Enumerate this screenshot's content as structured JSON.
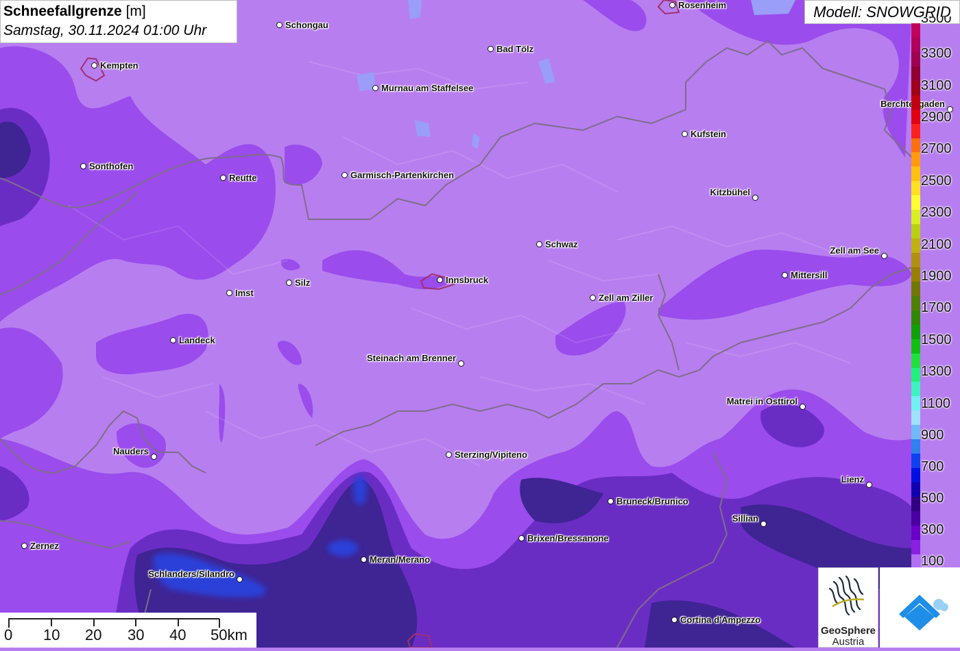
{
  "title": {
    "main": "Schneefallgrenze",
    "unit": "[m]",
    "datetime": "Samstag, 30.11.2024 01:00 Uhr"
  },
  "model": "Modell: SNOWGRID",
  "cities": [
    {
      "name": "Rosenheim",
      "side": "right"
    },
    {
      "name": "Schongau",
      "side": "right"
    },
    {
      "name": "Bad Tölz",
      "side": "right"
    },
    {
      "name": "Kempten",
      "side": "right"
    },
    {
      "name": "Murnau am Staffelsee",
      "side": "right"
    },
    {
      "name": "Berchtesgaden",
      "side": "left"
    },
    {
      "name": "Kufstein",
      "side": "right"
    },
    {
      "name": "Sonthofen",
      "side": "right"
    },
    {
      "name": "Reutte",
      "side": "right"
    },
    {
      "name": "Garmisch-Partenkirchen",
      "side": "right"
    },
    {
      "name": "Kitzbühel",
      "side": "left"
    },
    {
      "name": "Schwaz",
      "side": "right"
    },
    {
      "name": "Zell am See",
      "side": "left"
    },
    {
      "name": "Mittersill",
      "side": "right"
    },
    {
      "name": "Silz",
      "side": "right"
    },
    {
      "name": "Innsbruck",
      "side": "right"
    },
    {
      "name": "Imst",
      "side": "right"
    },
    {
      "name": "Zell am Ziller",
      "side": "right"
    },
    {
      "name": "Landeck",
      "side": "right"
    },
    {
      "name": "Steinach am Brenner",
      "side": "left"
    },
    {
      "name": "Matrei in Osttirol",
      "side": "left"
    },
    {
      "name": "Nauders",
      "side": "left"
    },
    {
      "name": "Sterzing/Vipiteno",
      "side": "right"
    },
    {
      "name": "Lienz",
      "side": "left"
    },
    {
      "name": "Bruneck/Brunico",
      "side": "right"
    },
    {
      "name": "Sillian",
      "side": "left"
    },
    {
      "name": "Brixen/Bressanone",
      "side": "right"
    },
    {
      "name": "Zernez",
      "side": "right"
    },
    {
      "name": "Meran/Merano",
      "side": "right"
    },
    {
      "name": "Schlanders/Silandro",
      "side": "left"
    },
    {
      "name": "Cortina d'Ampezzo",
      "side": "right"
    }
  ],
  "legend": {
    "labels": [
      "3300",
      "3100",
      "2900",
      "2700",
      "2500",
      "2300",
      "2100",
      "1900",
      "1700",
      "1500",
      "1300",
      "1100",
      "900",
      "700",
      "500",
      "300",
      "100"
    ],
    "top_partial_label": "3500",
    "colors": [
      "#c0005a",
      "#b0005a",
      "#a00050",
      "#900030",
      "#a00018",
      "#c00010",
      "#e00010",
      "#ff2020",
      "#ff7010",
      "#ff9a10",
      "#ffc010",
      "#ffe020",
      "#ffff30",
      "#d8f020",
      "#b8d010",
      "#c0b010",
      "#b09010",
      "#988000",
      "#707800",
      "#508000",
      "#308800",
      "#10a000",
      "#10c010",
      "#20e040",
      "#20f080",
      "#40f0c0",
      "#70f0f0",
      "#a0e0ff",
      "#70b8f8",
      "#3080f0",
      "#1040f0",
      "#0010e0",
      "#1000b0",
      "#300080",
      "#4a00a0",
      "#6a00c8",
      "#8a20e0",
      "#b070f0"
    ]
  },
  "scale": {
    "ticks": [
      "0",
      "10",
      "20",
      "30",
      "40",
      "50km"
    ]
  },
  "logos": {
    "geosphere_name": "GeoSphere",
    "geosphere_sub": "Austria"
  },
  "colors": {
    "background": "#b77ef0",
    "deep": "#4a2aa0",
    "mid": "#8a3ee8",
    "blue": "#2d3ed8",
    "border": "#7a6a8a"
  }
}
